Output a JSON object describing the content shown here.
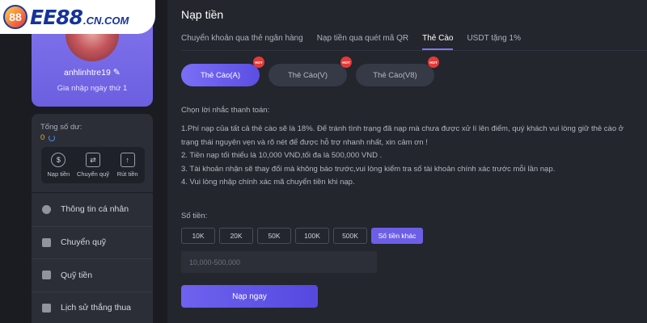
{
  "logo": {
    "mark": "88",
    "text": "EE88",
    "domain": ".CN.COM"
  },
  "profile": {
    "username": "anhlinhtre19",
    "edit_icon": "pencil-icon",
    "join_text": "Gia nhập ngày thứ 1"
  },
  "balance": {
    "label": "Tổng số dư:",
    "value": "0",
    "refresh_icon": "refresh-icon"
  },
  "quick_actions": [
    {
      "label": "Nạp tiền",
      "icon": "deposit-icon",
      "glyph": "$"
    },
    {
      "label": "Chuyển quỹ",
      "icon": "wallet-icon",
      "glyph": "⇄"
    },
    {
      "label": "Rút tiền",
      "icon": "withdraw-icon",
      "glyph": "↑"
    }
  ],
  "menu": [
    {
      "label": "Thông tin cá nhân",
      "icon": "user-icon"
    },
    {
      "label": "Chuyển quỹ",
      "icon": "wallet-icon"
    },
    {
      "label": "Quỹ tiền",
      "icon": "fund-icon"
    },
    {
      "label": "Lịch sử thắng thua",
      "icon": "history-icon"
    }
  ],
  "main": {
    "title": "Nạp tiền",
    "tabs": [
      {
        "label": "Chuyển khoản qua thẻ ngân hàng",
        "active": false
      },
      {
        "label": "Nạp tiền qua quét mã QR",
        "active": false
      },
      {
        "label": "Thẻ Cào",
        "active": true
      },
      {
        "label": "USDT tặng 1%",
        "active": false
      }
    ],
    "subtabs": [
      {
        "label": "Thẻ Cào(A)",
        "badge": "HOT",
        "active": true
      },
      {
        "label": "Thẻ Cào(V)",
        "badge": "HOT",
        "active": false
      },
      {
        "label": "Thẻ Cào(V8)",
        "badge": "HOT",
        "active": false
      }
    ],
    "notes_title": "Chọn lời nhắc thanh toán:",
    "notes": [
      "1.Phí nạp của tất cả thẻ cào sẽ là 18%. Để tránh tình trạng đã nạp mà chưa được xử lí lên điểm, quý khách vui lòng giữ thẻ cào ở trạng thái nguyên vẹn và rõ nét  để được hỗ trợ nhanh nhất, xin cảm ơn !",
      "2. Tiền nạp tối thiểu là 10,000 VND,tối đa là 500,000 VND .",
      "3. Tài khoản nhận sẽ thay đổi mà không báo trước,vui lòng kiểm tra số tài khoản chính xác trước mỗi lần nạp.",
      "4. Vui lòng nhập chính xác mã chuyển tiền khi nạp."
    ],
    "amount_label": "Số tiền:",
    "amount_options": [
      "10K",
      "20K",
      "50K",
      "100K",
      "500K"
    ],
    "other_amount": "Số tiền khác",
    "amount_placeholder": "10,000-500,000",
    "submit": "Nạp ngay"
  },
  "colors": {
    "accent": "#6c5fe6",
    "background": "#1a1c22",
    "panel": "#23262d",
    "hot_badge": "#e33a3a",
    "balance": "#e8b422"
  }
}
